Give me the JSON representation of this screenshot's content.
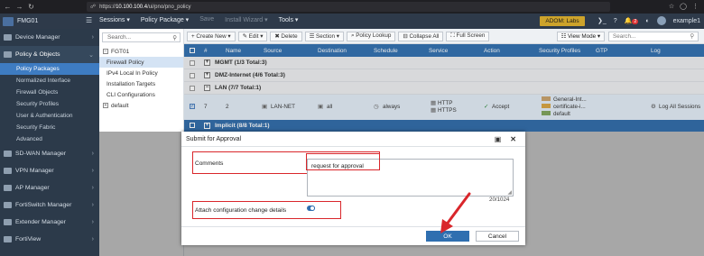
{
  "browser": {
    "url_prefix": "https://",
    "url_host": "10.100.100.4",
    "url_path": "/ui/pno/pno_policy",
    "icons": [
      "back-icon",
      "forward-icon",
      "reload-icon",
      "shield-icon",
      "star-icon",
      "profile-icon",
      "menu-icon"
    ]
  },
  "header": {
    "app_name": "FMG01",
    "menus": [
      {
        "label": "Sessions ▾",
        "enabled": true
      },
      {
        "label": "Policy Package ▾",
        "enabled": true
      },
      {
        "label": "Save",
        "enabled": false
      },
      {
        "label": "Install Wizard ▾",
        "enabled": false
      },
      {
        "label": "Tools ▾",
        "enabled": true
      }
    ],
    "adom": "ADOM: Labs",
    "notification_count": "2",
    "user": "example1"
  },
  "nav": {
    "items_top": [
      {
        "label": "Device Manager"
      },
      {
        "label": "Policy & Objects"
      }
    ],
    "sub_items": [
      {
        "label": "Policy Packages"
      },
      {
        "label": "Normalized Interface"
      },
      {
        "label": "Firewall Objects"
      },
      {
        "label": "Security Profiles"
      },
      {
        "label": "User & Authentication"
      },
      {
        "label": "Security Fabric"
      },
      {
        "label": "Advanced"
      }
    ],
    "items_bottom": [
      {
        "label": "SD-WAN Manager"
      },
      {
        "label": "VPN Manager"
      },
      {
        "label": "AP Manager"
      },
      {
        "label": "FortiSwitch Manager"
      },
      {
        "label": "Extender Manager"
      },
      {
        "label": "FortiView"
      }
    ]
  },
  "tree": {
    "search_placeholder": "Search...",
    "root": "FGT01",
    "children": [
      "Firewall Policy",
      "IPv4 Local In Policy",
      "Installation Targets",
      "CLI Configurations"
    ],
    "other": "default"
  },
  "toolbar": {
    "create_new": "+ Create New ▾",
    "edit": "✎ Edit ▾",
    "delete": "✖ Delete",
    "section": "☰ Section ▾",
    "policy_lookup": "⌕ Policy Lookup",
    "collapse_all": "⊟ Collapse All",
    "full_screen": "⛶ Full Screen",
    "view_mode": "☷ View Mode ▾",
    "search_placeholder": "Search..."
  },
  "table": {
    "columns": [
      "#",
      "Name",
      "Source",
      "Destination",
      "Schedule",
      "Service",
      "Action",
      "Security Profiles",
      "GTP",
      "Log"
    ],
    "groups": [
      "MGMT (1/3 Total:3)",
      "DMZ-Internet (4/6 Total:3)",
      "LAN (7/7 Total:1)"
    ],
    "row": {
      "seq": "7",
      "id": "2",
      "source": "LAN-NET",
      "destination": "all",
      "schedule": "always",
      "service1": "HTTP",
      "service2": "HTTPS",
      "action": "Accept",
      "profile1": "General-Int...",
      "profile2": "certificate-i...",
      "profile3": "default",
      "log": "Log All Sessions"
    },
    "implicit": "Implicit (8/8 Total:1)"
  },
  "dialog": {
    "title": "Submit for Approval",
    "comments_label": "Comments",
    "comments_value": "request for approval",
    "counter": "20/1024",
    "attach_label": "Attach configuration change details",
    "attach_on": true,
    "ok": "OK",
    "cancel": "Cancel"
  },
  "colors": {
    "accent": "#2f6fb0",
    "annotation": "#d9262b",
    "adom": "#cda32b"
  }
}
